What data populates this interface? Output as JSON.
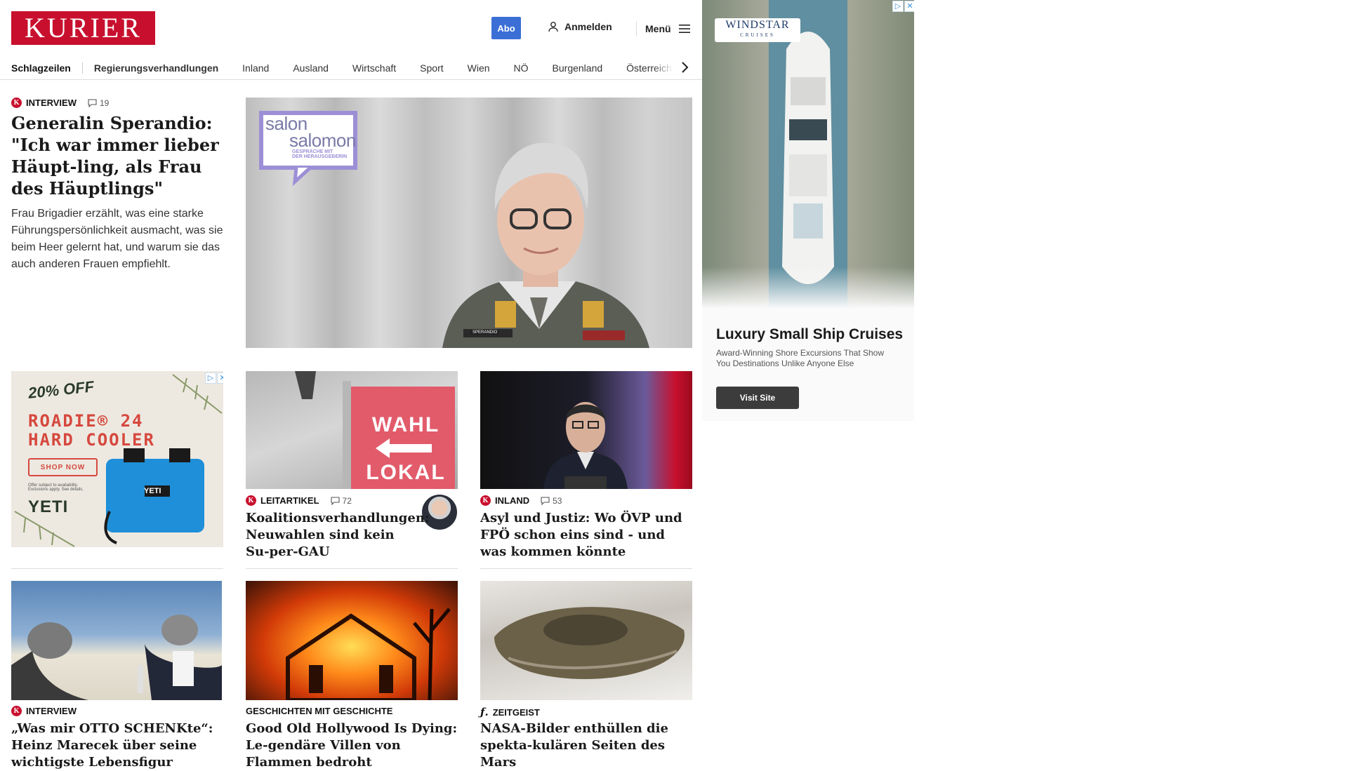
{
  "header": {
    "logo": "KURIER",
    "abo": "Abo",
    "login": "Anmelden",
    "menu": "Menü"
  },
  "nav": {
    "items": [
      "Schlagzeilen",
      "Regierungsverhandlungen",
      "Inland",
      "Ausland",
      "Wirtschaft",
      "Sport",
      "Wien",
      "NÖ",
      "Burgenland",
      "Österreich"
    ]
  },
  "lead": {
    "kicker": "INTERVIEW",
    "comments": "19",
    "title": "Generalin Sperandio: \"Ich war immer lieber Häupt-ling, als Frau des Häuptlings\"",
    "teaser": "Frau Brigadier erzählt, was eine starke Führungspersönlichkeit ausmacht, was sie beim Heer gelernt hat, und warum sie das auch anderen Frauen empfiehlt.",
    "badge_line1": "salon",
    "badge_line2": "salomon",
    "badge_sub1": "GESPRÄCHE MIT",
    "badge_sub2": "DER HERAUSGEBERIN",
    "nametag": "SPERANDIO"
  },
  "ad_yeti": {
    "discount": "20% OFF",
    "product_line1": "ROADIE® 24",
    "product_line2": "HARD COOLER",
    "cta": "SHOP NOW",
    "brand": "YETI",
    "fine1": "Offer subject to availability.",
    "fine2": "Exclusions apply. See details."
  },
  "articles": [
    {
      "kicker": "LEITARTIKEL",
      "comments": "72",
      "title": "Koalitionsverhandlungen: Neuwahlen sind kein Su-per-GAU",
      "sign_top": "WAHL",
      "sign_bottom": "LOKAL"
    },
    {
      "kicker": "INLAND",
      "comments": "53",
      "title": "Asyl und Justiz: Wo ÖVP und FPÖ schon eins sind - und was kommen könnte"
    },
    {
      "kicker": "INTERVIEW",
      "title": "„Was mir OTTO SCHENKte“: Heinz Marecek über seine wichtigste Lebensfigur"
    },
    {
      "kicker": "GESCHICHTEN MIT GESCHICHTE",
      "title": "Good Old Hollywood Is Dying: Le-gendäre Villen von Flammen bedroht"
    },
    {
      "kicker": "ZEITGEIST",
      "title": "NASA-Bilder enthüllen die spekta-kulären Seiten des Mars"
    }
  ],
  "ad_right": {
    "brand_line1": "WINDSTAR",
    "brand_line2": "CRUISES",
    "headline": "Luxury Small Ship Cruises",
    "text": "Award-Winning Shore Excursions That Show You Destinations Unlike Anyone Else",
    "cta": "Visit Site"
  },
  "colors": {
    "brand": "#c8102e",
    "abo": "#3b6fd6"
  }
}
